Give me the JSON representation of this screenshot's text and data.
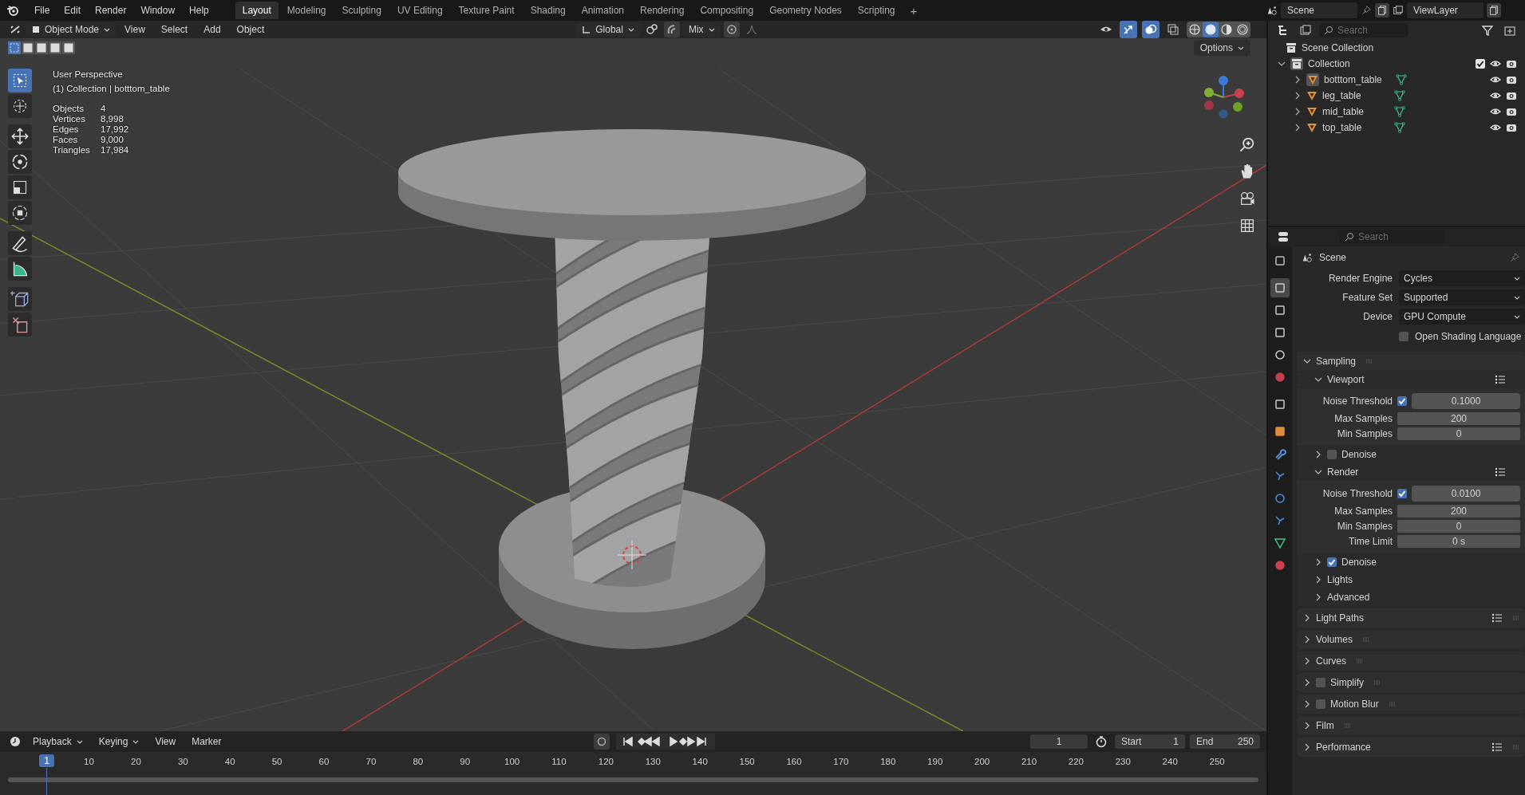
{
  "menu": [
    "File",
    "Edit",
    "Render",
    "Window",
    "Help"
  ],
  "workspaces": [
    {
      "label": "Layout",
      "selected": true
    },
    {
      "label": "Modeling",
      "selected": false
    },
    {
      "label": "Sculpting",
      "selected": false
    },
    {
      "label": "UV Editing",
      "selected": false
    },
    {
      "label": "Texture Paint",
      "selected": false
    },
    {
      "label": "Shading",
      "selected": false
    },
    {
      "label": "Animation",
      "selected": false
    },
    {
      "label": "Rendering",
      "selected": false
    },
    {
      "label": "Compositing",
      "selected": false
    },
    {
      "label": "Geometry Nodes",
      "selected": false
    },
    {
      "label": "Scripting",
      "selected": false
    }
  ],
  "add_workspace": "+",
  "scene": "Scene",
  "view_layer": "ViewLayer",
  "viewport_header": {
    "mode": "Object Mode",
    "menus": [
      "View",
      "Select",
      "Add",
      "Object"
    ],
    "orientation": "Global",
    "snap": "Mix",
    "options": "Options",
    "shading_modes": [
      {
        "selected": false
      },
      {
        "selected": true
      },
      {
        "selected": false
      },
      {
        "selected": false
      }
    ],
    "select_modes": [
      {
        "selected": true
      },
      {
        "selected": false
      },
      {
        "selected": false
      },
      {
        "selected": false
      },
      {
        "selected": false
      }
    ]
  },
  "viewport": {
    "title": "User Perspective",
    "context": "(1) Collection | botttom_table",
    "stats": [
      {
        "label": "Objects",
        "value": "4"
      },
      {
        "label": "Vertices",
        "value": "8,998"
      },
      {
        "label": "Edges",
        "value": "17,992"
      },
      {
        "label": "Faces",
        "value": "9,000"
      },
      {
        "label": "Triangles",
        "value": "17,984"
      }
    ],
    "tools": [
      {
        "selected": true
      },
      {
        "selected": false
      },
      {
        "selected": false
      },
      {
        "selected": false
      },
      {
        "selected": false
      },
      {
        "selected": false
      },
      {
        "selected": false
      },
      {
        "selected": false
      },
      {
        "selected": false
      },
      {
        "selected": false
      }
    ]
  },
  "outliner": {
    "search_placeholder": "Search",
    "root": "Scene Collection",
    "collection": {
      "name": "Collection",
      "expanded": true,
      "checked": true,
      "children": [
        {
          "name": "botttom_table",
          "selected": true
        },
        {
          "name": "leg_table",
          "selected": false
        },
        {
          "name": "mid_table",
          "selected": false
        },
        {
          "name": "top_table",
          "selected": false
        }
      ]
    }
  },
  "properties": {
    "search_placeholder": "Search",
    "context": "Scene",
    "tabs": [
      {
        "selected": false
      },
      {
        "selected": true
      },
      {
        "selected": false
      },
      {
        "selected": false
      },
      {
        "selected": false
      },
      {
        "selected": false
      },
      {
        "selected": false
      },
      {
        "selected": false
      },
      {
        "selected": false
      },
      {
        "selected": false
      },
      {
        "selected": false
      },
      {
        "selected": false
      },
      {
        "selected": false
      },
      {
        "selected": false
      }
    ],
    "fields": [
      {
        "label": "Render Engine",
        "value": "Cycles"
      },
      {
        "label": "Feature Set",
        "value": "Supported"
      },
      {
        "label": "Device",
        "value": "GPU Compute"
      }
    ],
    "osl": {
      "label": "Open Shading Language",
      "checked": false
    },
    "panels": [
      {
        "title": "Sampling",
        "expanded": true,
        "children": [
          {
            "title": "Viewport",
            "expanded": true,
            "presets": true,
            "rows": [
              {
                "kind": "check",
                "label": "Noise Threshold",
                "checked": true,
                "value": "0.1000"
              },
              {
                "kind": "value",
                "label": "Max Samples",
                "value": "200"
              },
              {
                "kind": "value",
                "label": "Min Samples",
                "value": "0"
              }
            ]
          },
          {
            "title": "Denoise",
            "expanded": false,
            "checkbox": false
          },
          {
            "title": "Render",
            "expanded": true,
            "presets": true,
            "rows": [
              {
                "kind": "check",
                "label": "Noise Threshold",
                "checked": true,
                "value": "0.0100"
              },
              {
                "kind": "value",
                "label": "Max Samples",
                "value": "200"
              },
              {
                "kind": "value",
                "label": "Min Samples",
                "value": "0"
              },
              {
                "kind": "value",
                "label": "Time Limit",
                "value": "0 s"
              }
            ]
          },
          {
            "title": "Denoise",
            "expanded": false,
            "checkbox": true
          },
          {
            "title": "Lights",
            "expanded": false
          },
          {
            "title": "Advanced",
            "expanded": false
          }
        ]
      },
      {
        "title": "Light Paths",
        "expanded": false,
        "presets": true
      },
      {
        "title": "Volumes",
        "expanded": false
      },
      {
        "title": "Curves",
        "expanded": false
      },
      {
        "title": "Simplify",
        "expanded": false,
        "checkbox": false
      },
      {
        "title": "Motion Blur",
        "expanded": false,
        "checkbox": false
      },
      {
        "title": "Film",
        "expanded": false
      },
      {
        "title": "Performance",
        "expanded": false,
        "presets": true
      }
    ]
  },
  "timeline": {
    "menus": [
      "Playback",
      "Keying",
      "View",
      "Marker"
    ],
    "current_frame": "1",
    "start_label": "Start",
    "start": "1",
    "end_label": "End",
    "end": "250",
    "frame_marker": "1",
    "ruler": [
      "10",
      "20",
      "30",
      "40",
      "50",
      "60",
      "70",
      "80",
      "90",
      "100",
      "110",
      "120",
      "130",
      "140",
      "150",
      "160",
      "170",
      "180",
      "190",
      "200",
      "210",
      "220",
      "230",
      "240",
      "250"
    ]
  }
}
